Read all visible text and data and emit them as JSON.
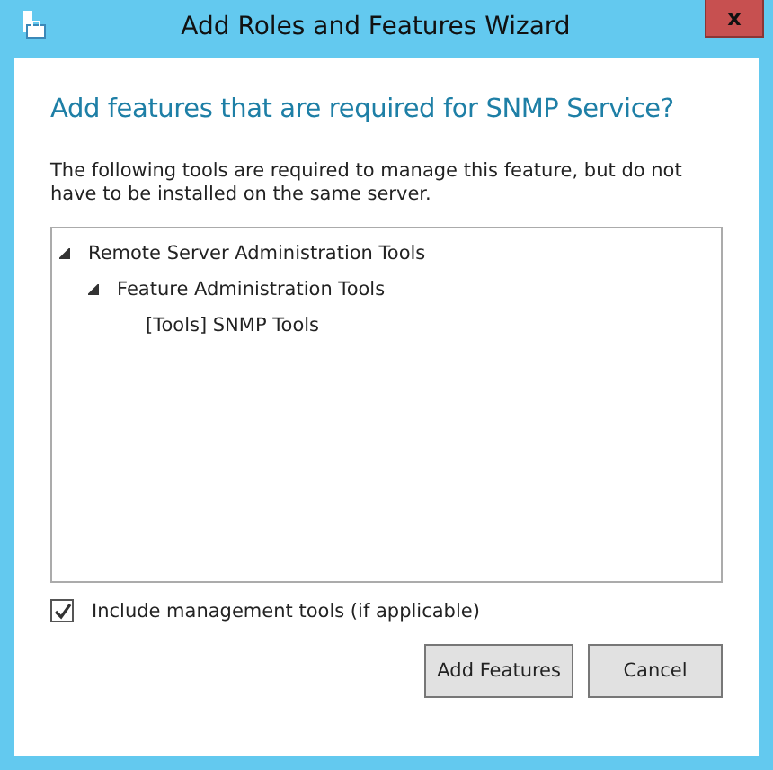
{
  "window": {
    "title": "Add Roles and Features Wizard",
    "close": "x"
  },
  "heading": "Add features that are required for SNMP Service?",
  "description": "The following tools are required to manage this feature, but do not have to be installed on the same server.",
  "tree": [
    {
      "label": "Remote Server Administration Tools",
      "expanded": true,
      "children": [
        {
          "label": "Feature Administration Tools",
          "expanded": true,
          "children": [
            {
              "label": "[Tools] SNMP Tools"
            }
          ]
        }
      ]
    }
  ],
  "include_tools": {
    "label": "Include management tools (if applicable)",
    "checked": true
  },
  "buttons": [
    "Add Features",
    "Cancel"
  ]
}
